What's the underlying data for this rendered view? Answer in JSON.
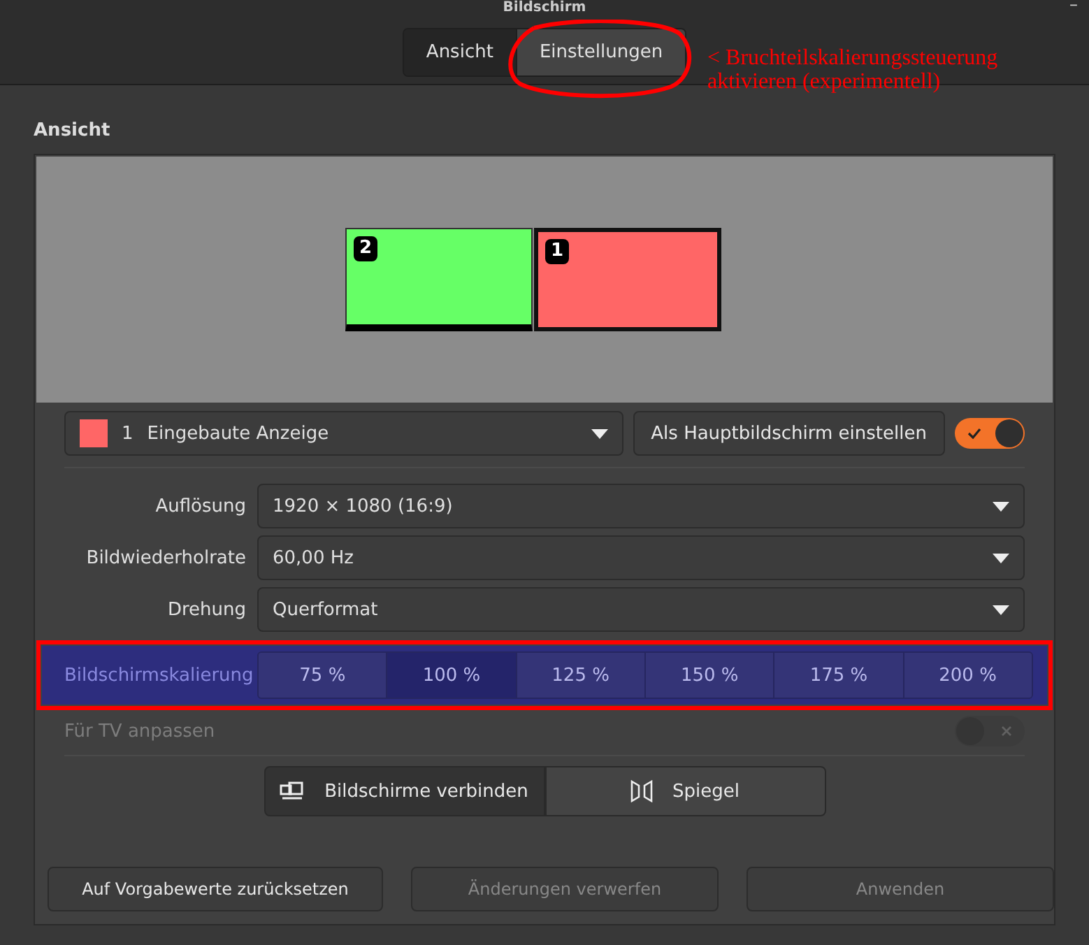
{
  "window": {
    "title": "Bildschirm",
    "minimize": "–"
  },
  "tabs": [
    {
      "label": "Ansicht",
      "selected": false
    },
    {
      "label": "Einstellungen",
      "selected": true
    }
  ],
  "annotation": {
    "text": "< Bruchteilskalierungssteuerung aktivieren (experimentell)"
  },
  "section_title": "Ansicht",
  "monitors": [
    {
      "number": "2",
      "color": "#66ff66",
      "selected": false
    },
    {
      "number": "1",
      "color": "#ff6666",
      "selected": true
    }
  ],
  "display": {
    "color": "#ff6666",
    "number": "1",
    "name": "Eingebaute Anzeige"
  },
  "primary_button": "Als Hauptbildschirm einstellen",
  "enabled_toggle": {
    "on": true
  },
  "settings": [
    {
      "label": "Auflösung",
      "value": "1920 × 1080 (16:9)"
    },
    {
      "label": "Bildwiederholrate",
      "value": "60,00 Hz"
    },
    {
      "label": "Drehung",
      "value": "Querformat"
    }
  ],
  "scaling": {
    "label": "Bildschirmskalierung",
    "options": [
      {
        "label": "75 %",
        "selected": false
      },
      {
        "label": "100 %",
        "selected": true
      },
      {
        "label": "125 %",
        "selected": false
      },
      {
        "label": "150 %",
        "selected": false
      },
      {
        "label": "175 %",
        "selected": false
      },
      {
        "label": "200 %",
        "selected": false
      }
    ]
  },
  "tv": {
    "label": "Für TV anpassen",
    "disabled": true,
    "on": false
  },
  "modes": [
    {
      "label": "Bildschirme verbinden",
      "kind": "join",
      "selected": true
    },
    {
      "label": "Spiegel",
      "kind": "mirror",
      "selected": false
    }
  ],
  "footer": [
    {
      "label": "Auf Vorgabewerte zurücksetzen",
      "disabled": false
    },
    {
      "label": "Änderungen verwerfen",
      "disabled": true
    },
    {
      "label": "Anwenden",
      "disabled": true
    }
  ]
}
